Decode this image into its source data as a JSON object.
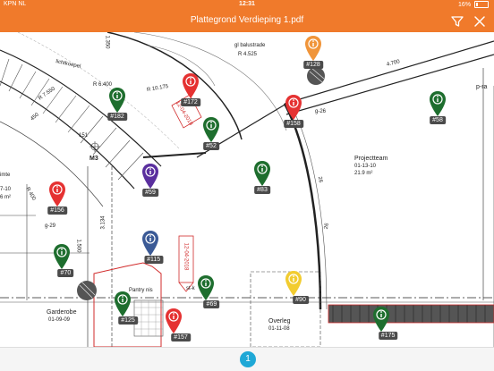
{
  "status": {
    "carrier": "KPN NL",
    "time": "12:31",
    "battery": "16%"
  },
  "header": {
    "title": "Plattegrond Verdieping 1.pdf"
  },
  "labels": {
    "balustrade": "gl balustrade",
    "r4525": "R 4.525",
    "lichtkoepel": "lichtkoepel",
    "r10175": "R 10.175",
    "r6400": "R 6.400",
    "r7550": "R 7.550",
    "dim1350": "1.350",
    "dim4700": "4.700",
    "dim450": "450",
    "dim151": "151",
    "m3": "M3",
    "imte": "imte",
    "n710": "7-10",
    "m6": "6 m²",
    "r400": "R 400",
    "g29": "g-29",
    "g26": "g-26",
    "dim26": "26",
    "dim26b": "26",
    "dim3134": "3.134",
    "dim1500": "1.500",
    "date1": "12-04-2018",
    "date2": "12-04-2018",
    "pantry": "Pantry nis",
    "stk": "st-k",
    "garderobe": "Garderobe",
    "garderobe_code": "01-09-09",
    "overleg": "Overleg",
    "overleg_code": "01-11-08",
    "projectteam": "Projectteam",
    "projectteam_code": "01-13-10",
    "projectteam_area": "21.9 m²",
    "pra": "p-ra"
  },
  "pins": [
    {
      "id": "#128",
      "color": "#f0953a"
    },
    {
      "id": "#172",
      "color": "#e53232"
    },
    {
      "id": "#182",
      "color": "#1e6e2e"
    },
    {
      "id": "#52",
      "color": "#1e6e2e"
    },
    {
      "id": "#158",
      "color": "#e53232"
    },
    {
      "id": "#58",
      "color": "#1e6e2e"
    },
    {
      "id": "#59",
      "color": "#5a2f9e"
    },
    {
      "id": "#83",
      "color": "#1e6e2e"
    },
    {
      "id": "#156",
      "color": "#e53232"
    },
    {
      "id": "#115",
      "color": "#3b5a96"
    },
    {
      "id": "#70",
      "color": "#1e6e2e"
    },
    {
      "id": "#69",
      "color": "#1e6e2e"
    },
    {
      "id": "#125",
      "color": "#1e6e2e"
    },
    {
      "id": "#90",
      "color": "#f2cc30"
    },
    {
      "id": "#157",
      "color": "#e53232"
    },
    {
      "id": "#175",
      "color": "#1e6e2e"
    }
  ],
  "page": {
    "current": "1"
  }
}
